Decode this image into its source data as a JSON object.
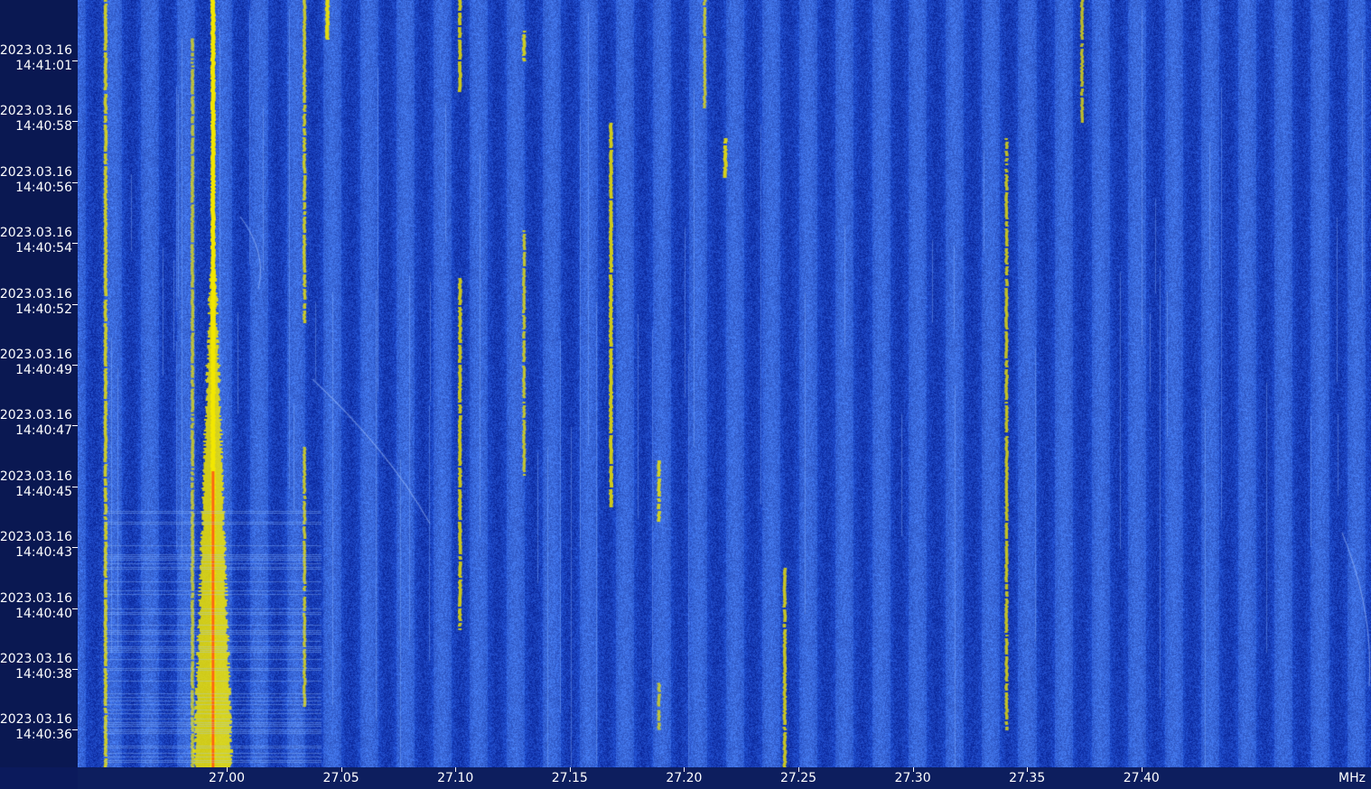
{
  "spectrogram": {
    "time_labels": [
      {
        "date": "2023.03.16",
        "time": "14:41:01"
      },
      {
        "date": "2023.03.16",
        "time": "14:40:58"
      },
      {
        "date": "2023.03.16",
        "time": "14:40:56"
      },
      {
        "date": "2023.03.16",
        "time": "14:40:54"
      },
      {
        "date": "2023.03.16",
        "time": "14:40:52"
      },
      {
        "date": "2023.03.16",
        "time": "14:40:49"
      },
      {
        "date": "2023.03.16",
        "time": "14:40:47"
      },
      {
        "date": "2023.03.16",
        "time": "14:40:45"
      },
      {
        "date": "2023.03.16",
        "time": "14:40:43"
      },
      {
        "date": "2023.03.16",
        "time": "14:40:40"
      },
      {
        "date": "2023.03.16",
        "time": "14:40:38"
      },
      {
        "date": "2023.03.16",
        "time": "14:40:36"
      }
    ],
    "freq_labels": [
      "27.00",
      "27.05",
      "27.10",
      "27.15",
      "27.20",
      "27.25",
      "27.30",
      "27.35",
      "27.40"
    ],
    "freq_unit": "MHz",
    "colors": {
      "background": "#1e4ac8",
      "band_light": "#3f78e0",
      "band_dark": "#143aa8",
      "signal": "#f2e600",
      "signal_hot": "#ff3a1a",
      "axis_bg": "#0d1e5e",
      "label": "#ffffff"
    },
    "signals": [
      {
        "freq": 26.981,
        "t_from": 0.0,
        "t_to": 1.0,
        "strength": 0.55
      },
      {
        "freq": 27.019,
        "t_from": 0.05,
        "t_to": 1.0,
        "strength": 0.5
      },
      {
        "freq": 27.028,
        "t_from": 0.0,
        "t_to": 1.0,
        "strength": 1.0
      },
      {
        "freq": 27.068,
        "t_from": 0.0,
        "t_to": 0.42,
        "strength": 0.5
      },
      {
        "freq": 27.068,
        "t_from": 0.58,
        "t_to": 0.92,
        "strength": 0.45
      },
      {
        "freq": 27.078,
        "t_from": 0.0,
        "t_to": 0.05,
        "strength": 0.8
      },
      {
        "freq": 27.136,
        "t_from": 0.0,
        "t_to": 0.12,
        "strength": 0.6
      },
      {
        "freq": 27.136,
        "t_from": 0.36,
        "t_to": 0.82,
        "strength": 0.6
      },
      {
        "freq": 27.164,
        "t_from": 0.04,
        "t_to": 0.08,
        "strength": 0.6
      },
      {
        "freq": 27.164,
        "t_from": 0.3,
        "t_to": 0.62,
        "strength": 0.45
      },
      {
        "freq": 27.202,
        "t_from": 0.16,
        "t_to": 0.66,
        "strength": 0.65
      },
      {
        "freq": 27.223,
        "t_from": 0.6,
        "t_to": 0.68,
        "strength": 0.6
      },
      {
        "freq": 27.223,
        "t_from": 0.89,
        "t_to": 0.95,
        "strength": 0.5
      },
      {
        "freq": 27.252,
        "t_from": 0.18,
        "t_to": 0.23,
        "strength": 0.7
      },
      {
        "freq": 27.243,
        "t_from": 0.0,
        "t_to": 0.14,
        "strength": 0.4
      },
      {
        "freq": 27.278,
        "t_from": 0.74,
        "t_to": 1.0,
        "strength": 0.55
      },
      {
        "freq": 27.375,
        "t_from": 0.18,
        "t_to": 0.95,
        "strength": 0.5
      },
      {
        "freq": 27.408,
        "t_from": 0.0,
        "t_to": 0.16,
        "strength": 0.45
      }
    ]
  }
}
